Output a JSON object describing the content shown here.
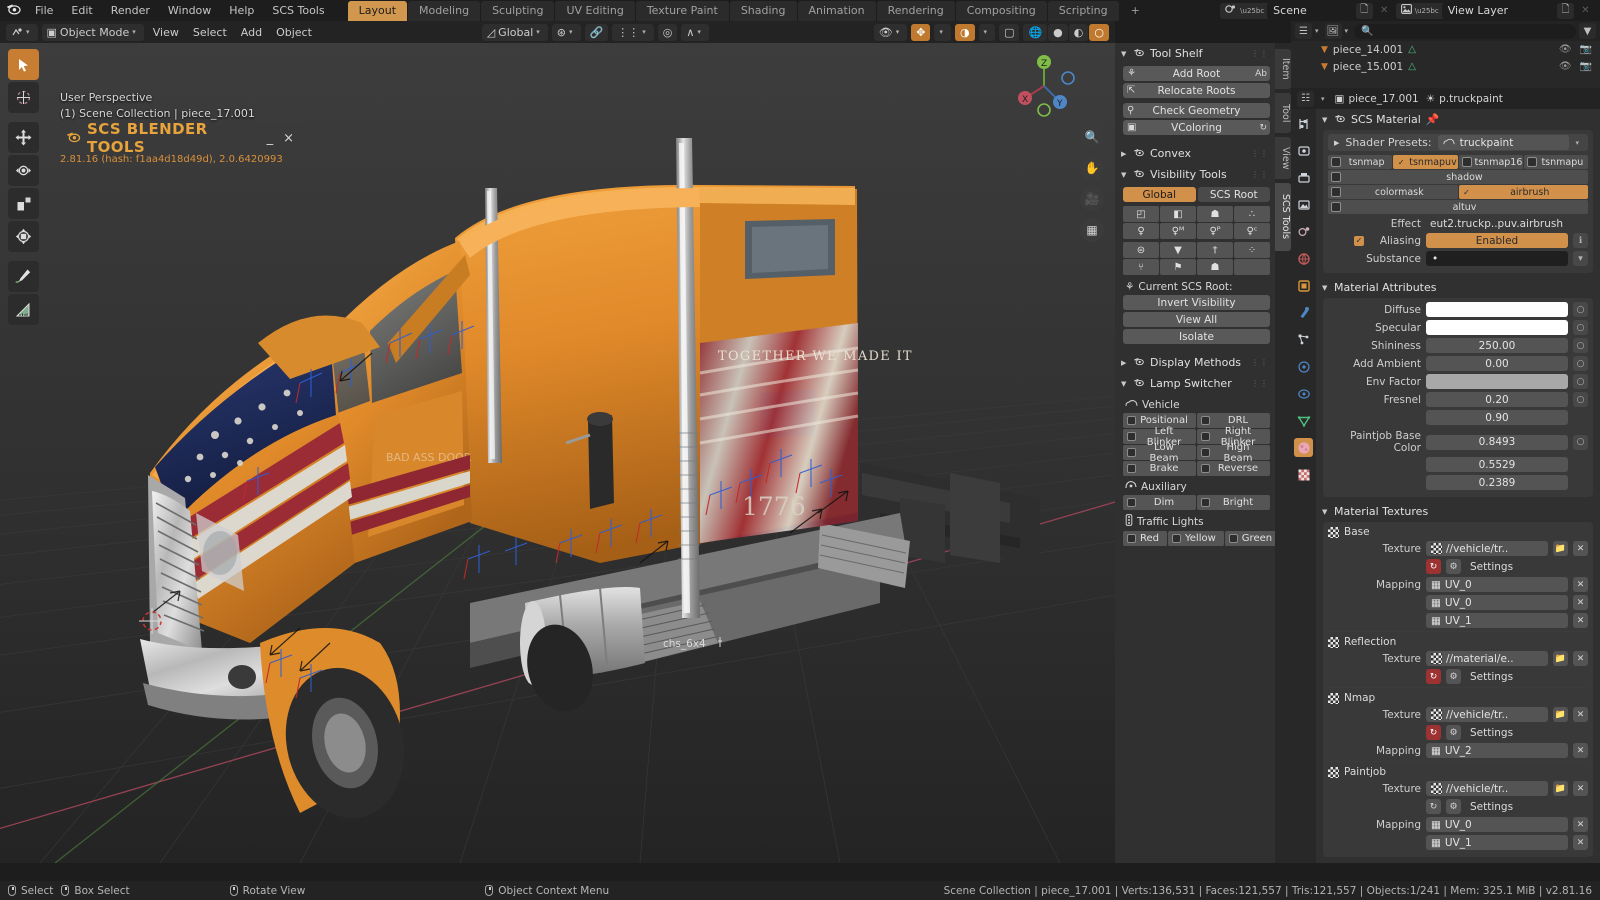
{
  "topbar": {
    "logo_icon": "blender-logo",
    "menus": [
      "File",
      "Edit",
      "Render",
      "Window",
      "Help",
      "SCS Tools"
    ],
    "workspace_tabs": [
      {
        "label": "Layout",
        "active": true
      },
      {
        "label": "Modeling",
        "active": false
      },
      {
        "label": "Sculpting",
        "active": false
      },
      {
        "label": "UV Editing",
        "active": false
      },
      {
        "label": "Texture Paint",
        "active": false
      },
      {
        "label": "Shading",
        "active": false
      },
      {
        "label": "Animation",
        "active": false
      },
      {
        "label": "Rendering",
        "active": false
      },
      {
        "label": "Compositing",
        "active": false
      },
      {
        "label": "Scripting",
        "active": false
      },
      {
        "label": "+",
        "active": false
      }
    ],
    "scene_name": "Scene",
    "view_layer_name": "View Layer"
  },
  "viewport_header": {
    "mode": "Object Mode",
    "menus": [
      "View",
      "Select",
      "Add",
      "Object"
    ],
    "transform_orientation": "Global",
    "overlay_icons": [
      "snap-magnet-icon",
      "proportional-edit-icon",
      "falloff-icon",
      "visibility-icon",
      "gizmo-icon",
      "overlays-icon",
      "xray-icon",
      "wireframe-shading-icon",
      "solid-shading-icon",
      "material-shading-icon",
      "rendered-shading-icon"
    ]
  },
  "viewport": {
    "perspective_label": "User Perspective",
    "collection_label": "(1) Scene Collection | piece_17.001",
    "addon_panel": {
      "title": "SCS BLENDER TOOLS",
      "version": "2.81.16 (hash: f1aa4d18d49d), 2.0.6420993",
      "minimize_label": "_",
      "close_label": "×"
    },
    "object_label": "chs_6x4",
    "decal_text": "TOGETHER WE MADE IT"
  },
  "left_toolbar": [
    {
      "name": "tweak-select-tool",
      "icon": "▶",
      "selected": true
    },
    {
      "name": "cursor-tool",
      "icon": "⊕",
      "selected": false
    },
    {
      "name": "move-tool",
      "icon": "✥",
      "selected": false
    },
    {
      "name": "rotate-tool",
      "icon": "⟳",
      "selected": false
    },
    {
      "name": "scale-tool",
      "icon": "◰",
      "selected": false
    },
    {
      "name": "transform-tool",
      "icon": "✣",
      "selected": false
    },
    {
      "name": "annotate-tool",
      "icon": "✎",
      "selected": false
    },
    {
      "name": "measure-tool",
      "icon": "◢",
      "selected": false
    }
  ],
  "side_tabs": [
    {
      "label": "Item",
      "selected": false
    },
    {
      "label": "Tool",
      "selected": false
    },
    {
      "label": "View",
      "selected": false
    },
    {
      "label": "SCS Tools",
      "selected": true
    }
  ],
  "tool_shelf": {
    "title": "Tool Shelf",
    "buttons": [
      {
        "label": "Add Root",
        "left_icon": "locator-icon",
        "right_icon": "Ab"
      },
      {
        "label": "Relocate Roots",
        "left_icon": "relocate-icon",
        "right_icon": ""
      },
      {
        "label": "Check Geometry",
        "left_icon": "search-geometry-icon",
        "right_icon": ""
      },
      {
        "label": "VColoring",
        "left_icon": "vcolor-icon",
        "right_icon": "↻"
      }
    ],
    "convex_title": "Convex",
    "visibility": {
      "title": "Visibility Tools",
      "scope_tabs": [
        {
          "label": "Global",
          "selected": true
        },
        {
          "label": "SCS Root",
          "selected": false
        }
      ],
      "icon_grid_1": [
        "◰",
        "◧",
        "☗",
        "∴",
        "♀",
        "♀ᴹ",
        "♀ᴾ",
        "♀ᶜ"
      ],
      "icon_grid_2": [
        "⊜",
        "▼",
        "†",
        "⁘",
        "⑂",
        "⚑",
        "☗",
        ""
      ],
      "current_root_label": "Current SCS Root:",
      "actions": [
        "Invert Visibility",
        "View All",
        "Isolate"
      ]
    },
    "display_methods_title": "Display Methods",
    "lamp_switcher": {
      "title": "Lamp Switcher",
      "groups": [
        {
          "name": "Vehicle",
          "icon": "vehicle-icon",
          "items": [
            "Positional",
            "DRL",
            "Left Blinker",
            "Right Blinker",
            "Low Beam",
            "High Beam",
            "Brake",
            "Reverse"
          ]
        },
        {
          "name": "Auxiliary",
          "icon": "auxiliary-icon",
          "items": [
            "Dim",
            "Bright"
          ]
        },
        {
          "name": "Traffic Lights",
          "icon": "traffic-light-icon",
          "items": [
            "Red",
            "Yellow",
            "Green"
          ]
        }
      ]
    }
  },
  "outliner": {
    "search_placeholder": "",
    "rows": [
      {
        "name": "piece_14.001",
        "type": "mesh"
      },
      {
        "name": "piece_15.001",
        "type": "mesh"
      }
    ]
  },
  "properties": {
    "breadcrumb": [
      "piece_17.001",
      "p.truckpaint"
    ],
    "nav_icons": [
      "tool-icon",
      "render-icon",
      "output-icon",
      "view-layer-icon",
      "scene-icon",
      "world-icon",
      "object-icon",
      "modifier-icon",
      "particles-icon",
      "physics-icon",
      "constraints-icon",
      "data-icon",
      "material-icon",
      "texture-icon"
    ],
    "scs_material": {
      "title": "SCS Material",
      "shader_presets_label": "Shader Presets:",
      "shader_preset_value": "truckpaint",
      "flags_row1": [
        {
          "label": "tsnmap",
          "on": false
        },
        {
          "label": "tsnmapuv",
          "on": true
        },
        {
          "label": "tsnmap16",
          "on": false
        },
        {
          "label": "tsnmapu",
          "on": false
        }
      ],
      "flags_row2": [
        {
          "label": "shadow",
          "on": false
        }
      ],
      "flags_row3": [
        {
          "label": "colormask",
          "on": false
        },
        {
          "label": "airbrush",
          "on": true
        }
      ],
      "flags_row4": [
        {
          "label": "altuv",
          "on": false
        }
      ],
      "effect_label": "Effect",
      "effect_value": "eut2.truckp..puv.airbrush",
      "aliasing_label": "Aliasing",
      "aliasing_value": "Enabled",
      "aliasing_on": true,
      "substance_label": "Substance",
      "substance_value": "•"
    },
    "material_attributes": {
      "title": "Material Attributes",
      "rows": [
        {
          "label": "Diffuse",
          "value": "",
          "kind": "color",
          "color": "#ffffff"
        },
        {
          "label": "Specular",
          "value": "",
          "kind": "color",
          "color": "#ffffff"
        },
        {
          "label": "Shininess",
          "value": "250.00",
          "kind": "num"
        },
        {
          "label": "Add Ambient",
          "value": "0.00",
          "kind": "num"
        },
        {
          "label": "Env Factor",
          "value": "",
          "kind": "color",
          "color": "#a8a8a8"
        },
        {
          "label": "Fresnel",
          "value": "0.20",
          "kind": "num"
        },
        {
          "label": "",
          "value": "0.90",
          "kind": "num"
        },
        {
          "label": "Paintjob Base Color",
          "value": "0.8493",
          "kind": "num"
        },
        {
          "label": "",
          "value": "0.5529",
          "kind": "num"
        },
        {
          "label": "",
          "value": "0.2389",
          "kind": "num"
        }
      ]
    },
    "material_textures": {
      "title": "Material Textures",
      "groups": [
        {
          "name": "Base",
          "texture_label": "Texture",
          "texture_value": "//vehicle/tr..",
          "settings_label": "Settings",
          "refresh_red": true,
          "mapping_label": "Mapping",
          "mappings": [
            "UV_0",
            "UV_0",
            "UV_1"
          ]
        },
        {
          "name": "Reflection",
          "texture_label": "Texture",
          "texture_value": "//material/e..",
          "settings_label": "Settings",
          "refresh_red": true,
          "mapping_label": "",
          "mappings": []
        },
        {
          "name": "Nmap",
          "texture_label": "Texture",
          "texture_value": "//vehicle/tr..",
          "settings_label": "Settings",
          "refresh_red": true,
          "mapping_label": "Mapping",
          "mappings": [
            "UV_2"
          ]
        },
        {
          "name": "Paintjob",
          "texture_label": "Texture",
          "texture_value": "//vehicle/tr..",
          "settings_label": "Settings",
          "refresh_red": false,
          "mapping_label": "Mapping",
          "mappings": [
            "UV_0",
            "UV_1"
          ]
        }
      ]
    }
  },
  "statusbar": {
    "keymap": [
      {
        "label": "Select",
        "icon": "mouse-left-icon"
      },
      {
        "label": "Box Select",
        "icon": "mouse-left-drag-icon"
      },
      {
        "label": "Rotate View",
        "icon": "mouse-middle-icon"
      },
      {
        "label": "Object Context Menu",
        "icon": "mouse-right-icon"
      }
    ],
    "stats": "Scene Collection | piece_17.001 | Verts:136,531 | Faces:121,557 | Tris:121,557 | Objects:1/241 | Mem: 325.1 MiB | v2.81.16"
  },
  "colors": {
    "accent": "#d2914b",
    "bg": "#1d1d1d",
    "panel": "#303030",
    "truck_orange": "#e08a2a"
  }
}
